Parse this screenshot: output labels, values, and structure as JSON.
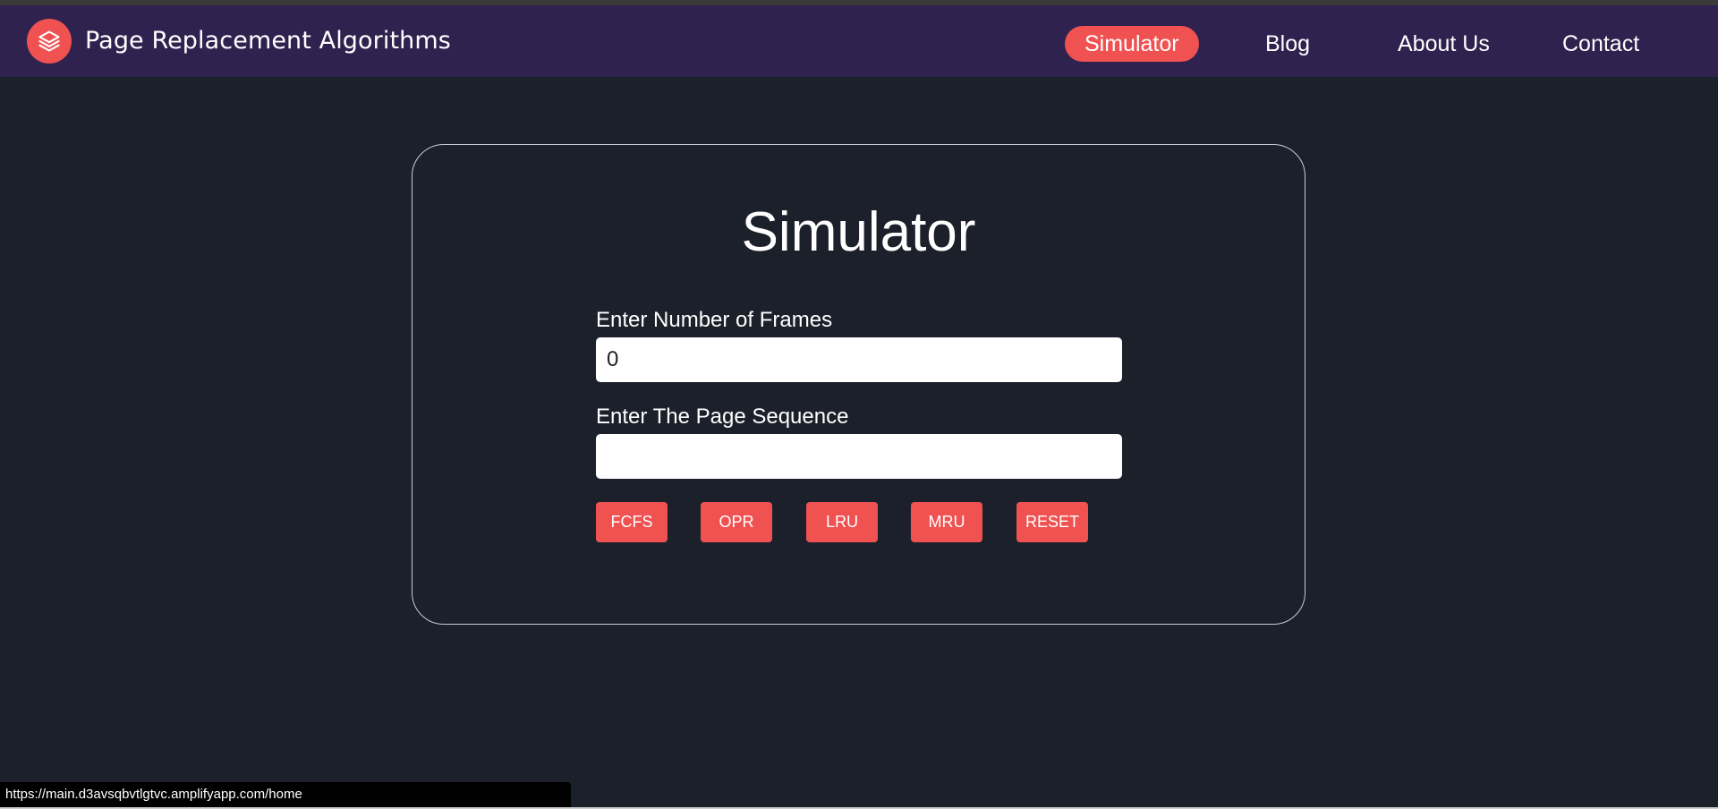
{
  "header": {
    "brand": "Page Replacement Algorithms",
    "logo_icon": "layers-icon",
    "nav": [
      {
        "label": "Simulator",
        "active": true
      },
      {
        "label": "Blog",
        "active": false
      },
      {
        "label": "About Us",
        "active": false
      },
      {
        "label": "Contact",
        "active": false
      }
    ]
  },
  "simulator": {
    "title": "Simulator",
    "frames_label": "Enter Number of Frames",
    "frames_value": "0",
    "sequence_label": "Enter The Page Sequence",
    "sequence_value": "",
    "buttons": [
      "FCFS",
      "OPR",
      "LRU",
      "MRU",
      "RESET"
    ]
  },
  "status_bar": {
    "url": "https://main.d3avsqbvtlgtvc.amplifyapp.com/home"
  },
  "colors": {
    "background": "#1c202b",
    "navbar": "#30224f",
    "accent": "#f05252"
  }
}
